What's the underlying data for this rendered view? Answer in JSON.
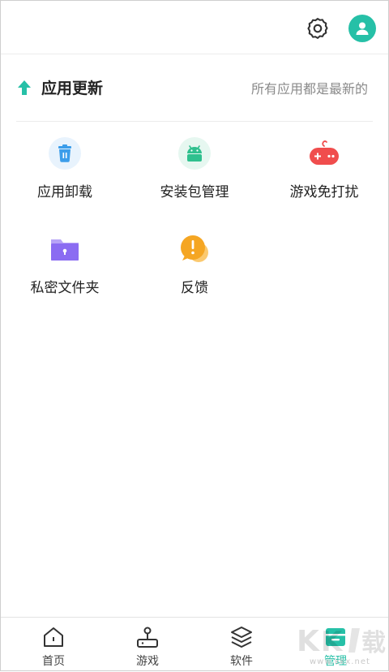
{
  "header": {
    "settings_icon": "gear-icon",
    "avatar_icon": "user-icon"
  },
  "update": {
    "icon": "arrow-up-icon",
    "title": "应用更新",
    "status": "所有应用都是最新的"
  },
  "tools": [
    {
      "label": "应用卸载",
      "icon": "trash-icon",
      "color": "#3b9dea"
    },
    {
      "label": "安装包管理",
      "icon": "android-icon",
      "color": "#2fc08e"
    },
    {
      "label": "游戏免打扰",
      "icon": "gamepad-icon",
      "color": "#f04d4d"
    },
    {
      "label": "私密文件夹",
      "icon": "lock-folder-icon",
      "color": "#8b6cf2"
    },
    {
      "label": "反馈",
      "icon": "feedback-icon",
      "color": "#f5a623"
    }
  ],
  "nav": {
    "items": [
      {
        "label": "首页",
        "icon": "home-icon"
      },
      {
        "label": "游戏",
        "icon": "joystick-icon"
      },
      {
        "label": "软件",
        "icon": "layers-icon"
      },
      {
        "label": "管理",
        "icon": "manage-icon",
        "active": true
      }
    ]
  },
  "colors": {
    "accent": "#26c0a7",
    "text": "#222222",
    "muted": "#8a8a8a"
  },
  "watermark": {
    "text": "www.kkx.net"
  }
}
